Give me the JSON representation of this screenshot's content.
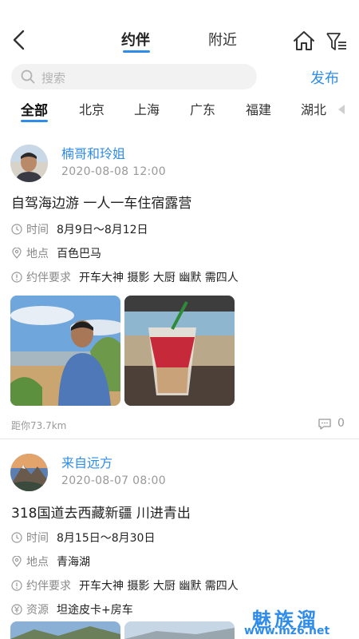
{
  "nav": {
    "tabs": [
      {
        "label": "约伴"
      },
      {
        "label": "附近"
      }
    ]
  },
  "search": {
    "placeholder": "搜索"
  },
  "publish_label": "发布",
  "regions": [
    "全部",
    "北京",
    "上海",
    "广东",
    "福建",
    "湖北"
  ],
  "accent_color": "#2f8ce8",
  "posts": [
    {
      "user": "楠哥和玲姐",
      "date": "2020-08-08 12:00",
      "title": "自驾海边游 一人一车住宿露营",
      "time_label": "时间",
      "time": "8月9日～8月12日",
      "place_label": "地点",
      "place": "百色巴马",
      "req_label": "约伴要求",
      "requirements": "开车大神 摄影 大厨 幽默 需四人",
      "distance": "距你73.7km",
      "comments": "0"
    },
    {
      "user": "来自远方",
      "date": "2020-08-07 08:00",
      "title": "318国道去西藏新疆 川进青出",
      "time_label": "时间",
      "time": "8月15日～8月30日",
      "place_label": "地点",
      "place": "青海湖",
      "req_label": "约伴要求",
      "requirements": "开车大神 摄影 大厨 幽默 需四人",
      "resource_label": "资源",
      "resource": "坦途皮卡+房车"
    }
  ],
  "watermark": {
    "main": "魅族溜",
    "sub": "www.mz6.net"
  }
}
